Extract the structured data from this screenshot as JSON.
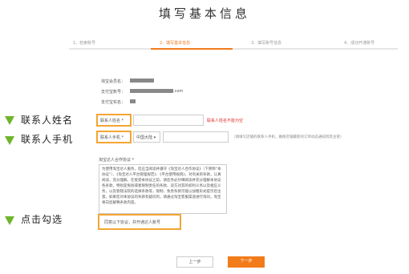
{
  "page": {
    "title": "填写基本信息"
  },
  "steps": [
    "1、检索账号",
    "2、填写基本信息",
    "3、填写账号信息",
    "4、成功开通账号"
  ],
  "info": {
    "shop_label": "淘宝会员名：",
    "alipay_label": "支付宝账号：",
    "alipay_suffix": ".com",
    "realname_label": "支付宝实名："
  },
  "annotations": {
    "contact_name": "联系人姓名",
    "contact_phone": "联系人手机",
    "click_check": "点击勾选"
  },
  "form": {
    "name_label": "联系人姓名 *",
    "name_error": "联系人姓名不能为空",
    "phone_label": "联系人手机 *",
    "country_value": "中国大陆 ▾",
    "phone_hint": "（请填写店铺的联系人手机，确保店铺最新的订单动态通知到其主管）",
    "agreement_label": "淘宝达人合作协议 *",
    "agreement_text": "为使用淘宝达人服务，您应当阅读并遵守《淘宝达人合作协议》（下简称“本协议”）、《淘宝达人平台管理规范》、《平台使用规则》，对有关的条款，认真阅读、充分理解。在接受本协议之前，请您务必仔细阅读并充分理解本协议各条款，特别是免除或者限制责任的条款、双方对其的权利义务以及相应义务，以及管辖法院的选择条款等，限制、免责条款可能以加粗形式提示您注意。如果您对本协议的条款有疑问的，请通过淘宝客服渠道进行询问，淘宝将向您解释条款内容。",
    "agree_text": "同意以下协议，并开通达人账号"
  },
  "buttons": {
    "prev": "上一步",
    "next": "下一步"
  },
  "colors": {
    "accent": "#f27b1a",
    "highlight": "#f4a534",
    "annotation_marker": "#6fb52c",
    "error": "#e0302b"
  }
}
